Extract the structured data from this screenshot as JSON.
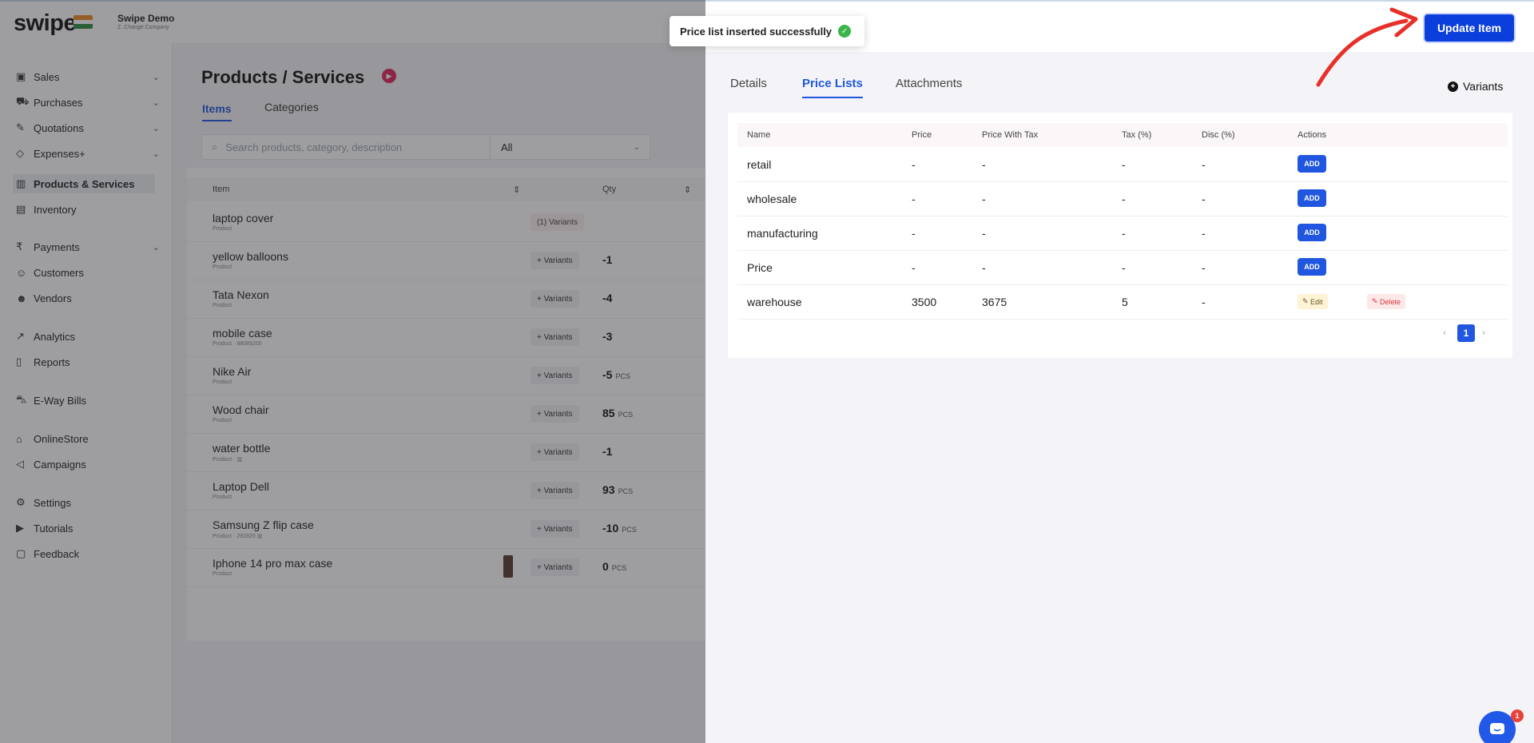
{
  "header": {
    "logo": "swipe",
    "company_name": "Swipe Demo",
    "company_sub": "Z. Change Company"
  },
  "sidebar": {
    "items": [
      {
        "label": "Sales",
        "icon": "cash-icon",
        "chevron": "⌄"
      },
      {
        "label": "Purchases",
        "icon": "cart-icon",
        "chevron": "⌄"
      },
      {
        "label": "Quotations",
        "icon": "pen-icon",
        "chevron": "⌄"
      },
      {
        "label": "Expenses+",
        "icon": "tag-icon",
        "chevron": "⌄"
      },
      {
        "label": "Products & Services",
        "icon": "barcode-icon"
      },
      {
        "label": "Inventory",
        "icon": "warehouse-icon"
      },
      {
        "label": "Payments",
        "icon": "rupee-icon",
        "chevron": "⌄"
      },
      {
        "label": "Customers",
        "icon": "user-icon"
      },
      {
        "label": "Vendors",
        "icon": "users-icon"
      },
      {
        "label": "Analytics",
        "icon": "chart-icon"
      },
      {
        "label": "Reports",
        "icon": "report-icon"
      },
      {
        "label": "E-Way Bills",
        "icon": "truck-icon"
      },
      {
        "label": "OnlineStore",
        "icon": "store-icon"
      },
      {
        "label": "Campaigns",
        "icon": "megaphone-icon"
      },
      {
        "label": "Settings",
        "icon": "gear-icon"
      },
      {
        "label": "Tutorials",
        "icon": "youtube-icon"
      },
      {
        "label": "Feedback",
        "icon": "chat-icon"
      }
    ]
  },
  "main": {
    "title": "Products / Services",
    "tabs": [
      "Items",
      "Categories"
    ],
    "search_placeholder": "Search products, category, description",
    "filter_value": "All",
    "columns": {
      "item": "Item",
      "qty": "Qty"
    },
    "rows": [
      {
        "name": "laptop cover",
        "sub": "Product",
        "variants": "(1) Variants",
        "qty": "",
        "unit": ""
      },
      {
        "name": "yellow balloons",
        "sub": "Product",
        "variants": "+ Variants",
        "qty": "-1",
        "unit": ""
      },
      {
        "name": "Tata Nexon",
        "sub": "Product",
        "variants": "+ Variants",
        "qty": "-4",
        "unit": ""
      },
      {
        "name": "mobile case",
        "sub": "Product · 88089200",
        "variants": "+ Variants",
        "qty": "-3",
        "unit": ""
      },
      {
        "name": "Nike Air",
        "sub": "Product",
        "variants": "+ Variants",
        "qty": "-5",
        "unit": "PCS"
      },
      {
        "name": "Wood chair",
        "sub": "Product",
        "variants": "+ Variants",
        "qty": "85",
        "unit": "PCS"
      },
      {
        "name": "water bottle",
        "sub": "Product · ▥",
        "variants": "+ Variants",
        "qty": "-1",
        "unit": ""
      },
      {
        "name": "Laptop Dell",
        "sub": "Product",
        "variants": "+ Variants",
        "qty": "93",
        "unit": "PCS"
      },
      {
        "name": "Samsung Z flip case",
        "sub": "Product · 292820 ▥",
        "variants": "+ Variants",
        "qty": "-10",
        "unit": "PCS"
      },
      {
        "name": "Iphone 14 pro max case",
        "sub": "Product",
        "variants": "+ Variants",
        "qty": "0",
        "unit": "PCS"
      }
    ]
  },
  "toast": {
    "message": "Price list inserted successfully",
    "icon": "check-icon"
  },
  "drawer": {
    "update_label": "Update Item",
    "tabs": [
      "Details",
      "Price Lists",
      "Attachments"
    ],
    "variants_label": "Variants",
    "columns": [
      "Name",
      "Price",
      "Price With Tax",
      "Tax (%)",
      "Disc (%)",
      "Actions"
    ],
    "price_lists": [
      {
        "name": "retail",
        "price": "-",
        "price_with_tax": "-",
        "tax": "-",
        "disc": "-",
        "action": "ADD"
      },
      {
        "name": "wholesale",
        "price": "-",
        "price_with_tax": "-",
        "tax": "-",
        "disc": "-",
        "action": "ADD"
      },
      {
        "name": "manufacturing",
        "price": "-",
        "price_with_tax": "-",
        "tax": "-",
        "disc": "-",
        "action": "ADD"
      },
      {
        "name": "Price",
        "price": "-",
        "price_with_tax": "-",
        "tax": "-",
        "disc": "-",
        "action": "ADD"
      },
      {
        "name": "warehouse",
        "price": "3500",
        "price_with_tax": "3675",
        "tax": "5",
        "disc": "-",
        "edit": "Edit",
        "delete": "Delete"
      }
    ],
    "pagination": {
      "prev": "‹",
      "current": "1",
      "next": "›"
    }
  },
  "chat": {
    "badge": "1"
  },
  "colors": {
    "primary": "#2157e0",
    "update_button": "#0b3fdb",
    "success": "#3bb54a",
    "annotation_arrow": "#e8302a"
  }
}
